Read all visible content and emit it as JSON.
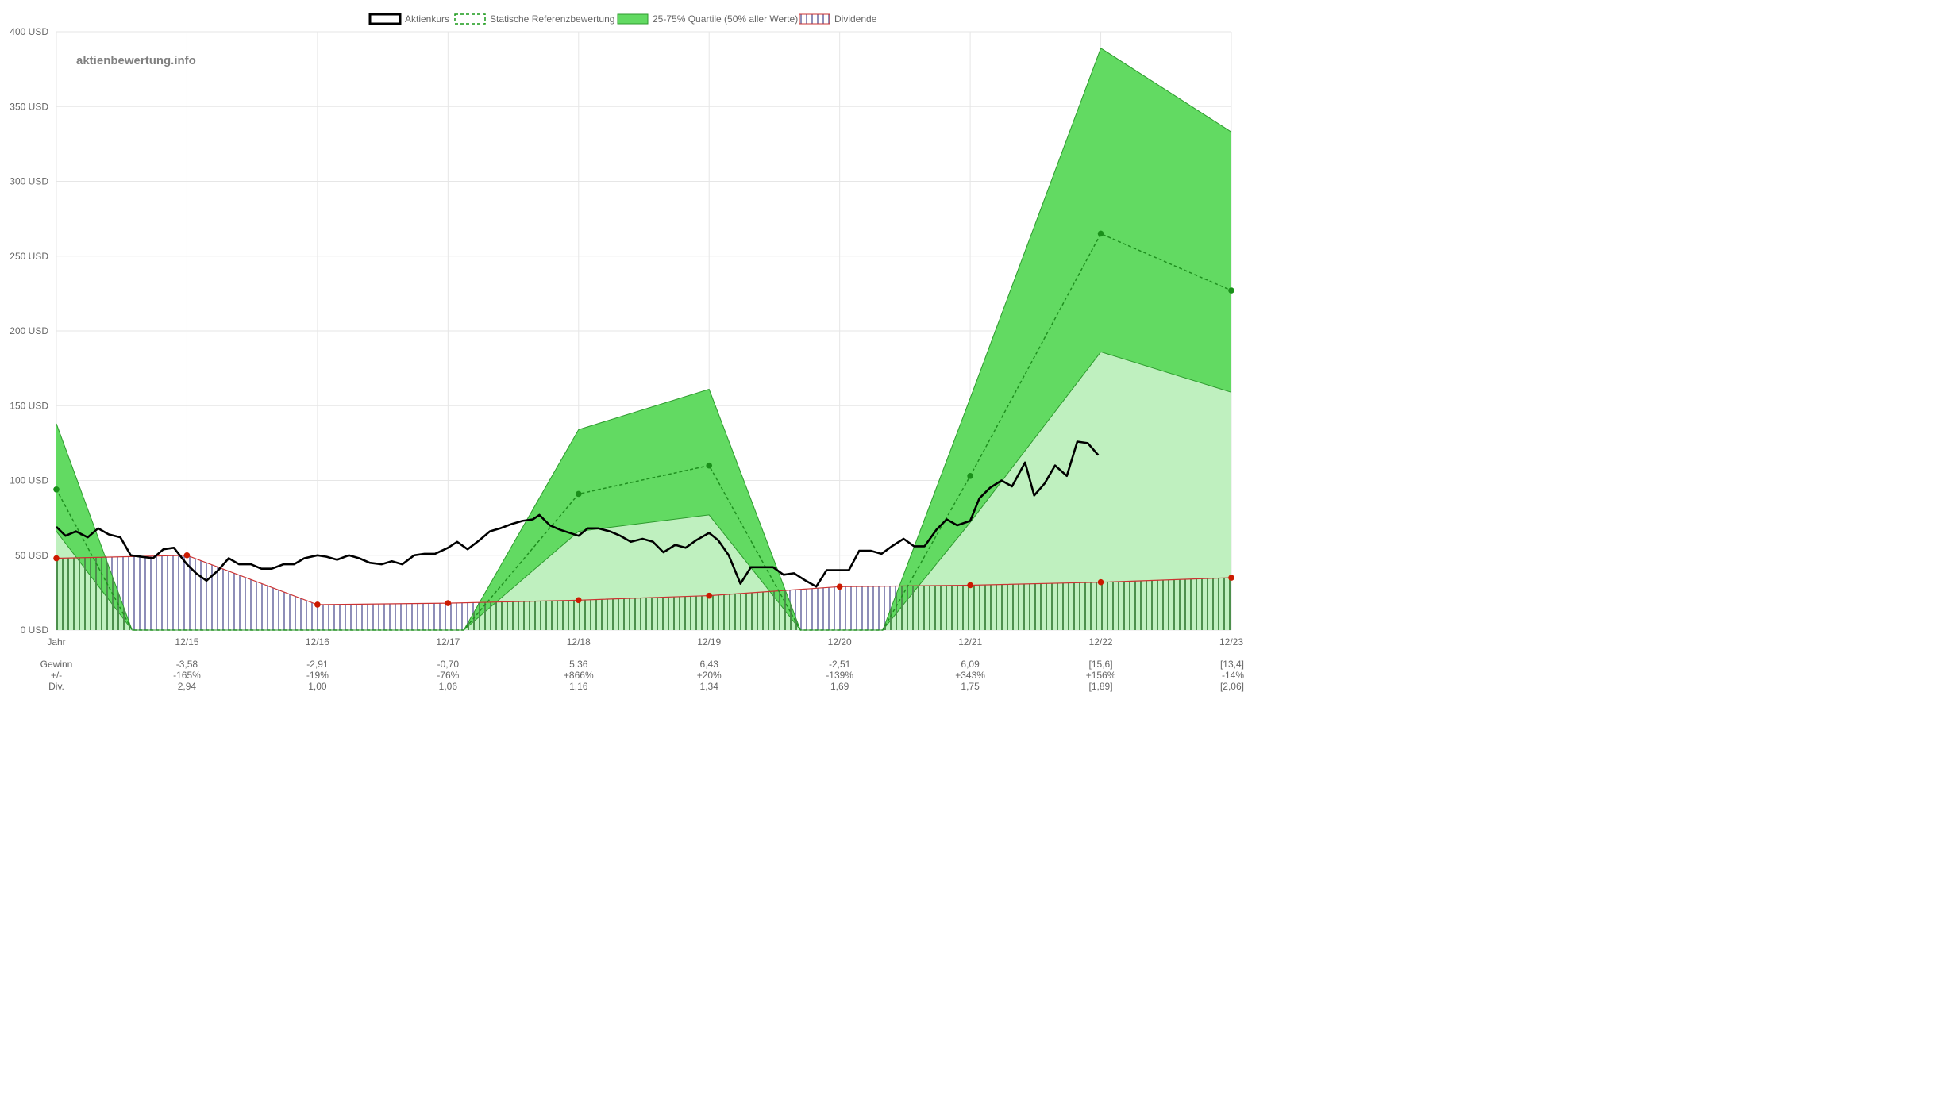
{
  "watermark": "aktienbewertung.info",
  "legend": [
    {
      "label": "Aktienkurs",
      "kind": "line-solid",
      "color": "#000000"
    },
    {
      "label": "Statische Referenzbewertung",
      "kind": "line-dashed",
      "color": "#1a9a1a"
    },
    {
      "label": "25-75% Quartile (50% aller Werte)",
      "kind": "fill",
      "color": "#5fdc5f"
    },
    {
      "label": "Dividende",
      "kind": "hatch",
      "color": "#cc3333"
    }
  ],
  "colors": {
    "price": "#000000",
    "reference": "#1f8f1f",
    "upper_band": "#62da62",
    "lower_band": "#bff0bf",
    "band_edge": "#2e9a2e",
    "dividend_line": "#cc3333",
    "dividend_dot": "#cc1a00",
    "dividend_hatch_blue": "#8e8eb8",
    "dividend_hatch_green": "#4c8f4c",
    "grid": "#e6e6e6"
  },
  "row_labels": [
    "Gewinn",
    "+/-",
    "Div."
  ],
  "chart_data": {
    "type": "line",
    "ylim": [
      0,
      400
    ],
    "y_ticks": [
      0,
      50,
      100,
      150,
      200,
      250,
      300,
      350,
      400
    ],
    "y_tick_labels": [
      "0 USD",
      "50 USD",
      "100 USD",
      "150 USD",
      "200 USD",
      "250 USD",
      "300 USD",
      "350 USD",
      "400 USD"
    ],
    "x_domain": [
      2014.0,
      2023.0
    ],
    "x_ticks": [
      2014.0,
      2015.0,
      2016.0,
      2017.0,
      2018.0,
      2019.0,
      2020.0,
      2021.0,
      2022.0,
      2023.0
    ],
    "x_tick_labels": [
      "Jahr",
      "12/15",
      "12/16",
      "12/17",
      "12/18",
      "12/19",
      "12/20",
      "12/21",
      "12/22",
      "12/23"
    ],
    "table": {
      "gewinn": [
        "-3,58",
        "-2,91",
        "-0,70",
        "5,36",
        "6,43",
        "-2,51",
        "6,09",
        "[15,6]",
        "[13,4]"
      ],
      "change": [
        "-165%",
        "-19%",
        "-76%",
        "+866%",
        "+20%",
        "-139%",
        "+343%",
        "+156%",
        "-14%"
      ],
      "dividende": [
        "2,94",
        "1,00",
        "1,06",
        "1,16",
        "1,34",
        "1,69",
        "1,75",
        "[1,89]",
        "[2,06]"
      ]
    },
    "series": [
      {
        "name": "Aktienkurs",
        "points": [
          [
            2014.0,
            69
          ],
          [
            2014.07,
            63
          ],
          [
            2014.15,
            66
          ],
          [
            2014.24,
            62
          ],
          [
            2014.32,
            68
          ],
          [
            2014.4,
            64
          ],
          [
            2014.49,
            62
          ],
          [
            2014.57,
            50
          ],
          [
            2014.65,
            49
          ],
          [
            2014.74,
            48
          ],
          [
            2014.82,
            54
          ],
          [
            2014.9,
            55
          ],
          [
            2015.0,
            44
          ],
          [
            2015.07,
            38
          ],
          [
            2015.15,
            33
          ],
          [
            2015.24,
            40
          ],
          [
            2015.32,
            48
          ],
          [
            2015.4,
            44
          ],
          [
            2015.49,
            44
          ],
          [
            2015.57,
            41
          ],
          [
            2015.65,
            41
          ],
          [
            2015.74,
            44
          ],
          [
            2015.82,
            44
          ],
          [
            2015.9,
            48
          ],
          [
            2016.0,
            50
          ],
          [
            2016.07,
            49
          ],
          [
            2016.15,
            47
          ],
          [
            2016.24,
            50
          ],
          [
            2016.32,
            48
          ],
          [
            2016.4,
            45
          ],
          [
            2016.49,
            44
          ],
          [
            2016.57,
            46
          ],
          [
            2016.65,
            44
          ],
          [
            2016.74,
            50
          ],
          [
            2016.82,
            51
          ],
          [
            2016.9,
            51
          ],
          [
            2017.0,
            55
          ],
          [
            2017.07,
            59
          ],
          [
            2017.15,
            54
          ],
          [
            2017.24,
            60
          ],
          [
            2017.32,
            66
          ],
          [
            2017.4,
            68
          ],
          [
            2017.49,
            71
          ],
          [
            2017.57,
            73
          ],
          [
            2017.65,
            74
          ],
          [
            2017.7,
            77
          ],
          [
            2017.78,
            70
          ],
          [
            2017.86,
            67
          ],
          [
            2018.0,
            63
          ],
          [
            2018.07,
            68
          ],
          [
            2018.15,
            68
          ],
          [
            2018.24,
            66
          ],
          [
            2018.32,
            63
          ],
          [
            2018.4,
            59
          ],
          [
            2018.49,
            61
          ],
          [
            2018.57,
            59
          ],
          [
            2018.65,
            52
          ],
          [
            2018.74,
            57
          ],
          [
            2018.82,
            55
          ],
          [
            2018.9,
            60
          ],
          [
            2019.0,
            65
          ],
          [
            2019.07,
            60
          ],
          [
            2019.15,
            50
          ],
          [
            2019.24,
            31
          ],
          [
            2019.32,
            42
          ],
          [
            2019.4,
            42
          ],
          [
            2019.49,
            42
          ],
          [
            2019.57,
            37
          ],
          [
            2019.65,
            38
          ],
          [
            2019.74,
            33
          ],
          [
            2019.82,
            29
          ],
          [
            2019.9,
            40
          ],
          [
            2020.0,
            40
          ],
          [
            2020.07,
            40
          ],
          [
            2020.15,
            53
          ],
          [
            2020.24,
            53
          ],
          [
            2020.32,
            51
          ],
          [
            2020.4,
            56
          ],
          [
            2020.49,
            61
          ],
          [
            2020.57,
            56
          ],
          [
            2020.65,
            56
          ],
          [
            2020.74,
            67
          ],
          [
            2020.82,
            74
          ],
          [
            2020.9,
            70
          ],
          [
            2021.0,
            73
          ],
          [
            2021.07,
            88
          ],
          [
            2021.15,
            95
          ],
          [
            2021.24,
            100
          ],
          [
            2021.32,
            96
          ],
          [
            2021.42,
            112
          ],
          [
            2021.49,
            90
          ],
          [
            2021.57,
            98
          ],
          [
            2021.65,
            110
          ],
          [
            2021.74,
            103
          ],
          [
            2021.82,
            126
          ],
          [
            2021.9,
            125
          ],
          [
            2021.98,
            117
          ]
        ]
      },
      {
        "name": "Statische Referenzbewertung",
        "points": [
          [
            2014.0,
            94
          ],
          [
            2014.58,
            0
          ],
          [
            2017.12,
            0
          ],
          [
            2018.0,
            91
          ],
          [
            2019.0,
            110
          ],
          [
            2019.7,
            0
          ],
          [
            2020.33,
            0
          ],
          [
            2021.0,
            103
          ],
          [
            2022.0,
            265
          ],
          [
            2023.0,
            227
          ]
        ]
      },
      {
        "name": "25-75% Quartile (50% aller Werte)",
        "upper": [
          [
            2014.0,
            138
          ],
          [
            2014.58,
            0
          ],
          [
            2017.12,
            0
          ],
          [
            2018.0,
            134
          ],
          [
            2019.0,
            161
          ],
          [
            2019.7,
            0
          ],
          [
            2020.33,
            0
          ],
          [
            2021.0,
            155
          ],
          [
            2022.0,
            389
          ],
          [
            2023.0,
            333
          ]
        ],
        "lower": [
          [
            2014.0,
            66
          ],
          [
            2014.58,
            0
          ],
          [
            2017.12,
            0
          ],
          [
            2018.0,
            66
          ],
          [
            2019.0,
            77
          ],
          [
            2019.7,
            0
          ],
          [
            2020.33,
            0
          ],
          [
            2021.0,
            72
          ],
          [
            2022.0,
            186
          ],
          [
            2023.0,
            159
          ]
        ]
      },
      {
        "name": "Dividende",
        "points": [
          [
            2014.0,
            48
          ],
          [
            2015.0,
            50
          ],
          [
            2016.0,
            17
          ],
          [
            2017.0,
            18
          ],
          [
            2018.0,
            20
          ],
          [
            2019.0,
            23
          ],
          [
            2020.0,
            29
          ],
          [
            2021.0,
            30
          ],
          [
            2022.0,
            32
          ],
          [
            2023.0,
            35
          ]
        ]
      }
    ]
  }
}
